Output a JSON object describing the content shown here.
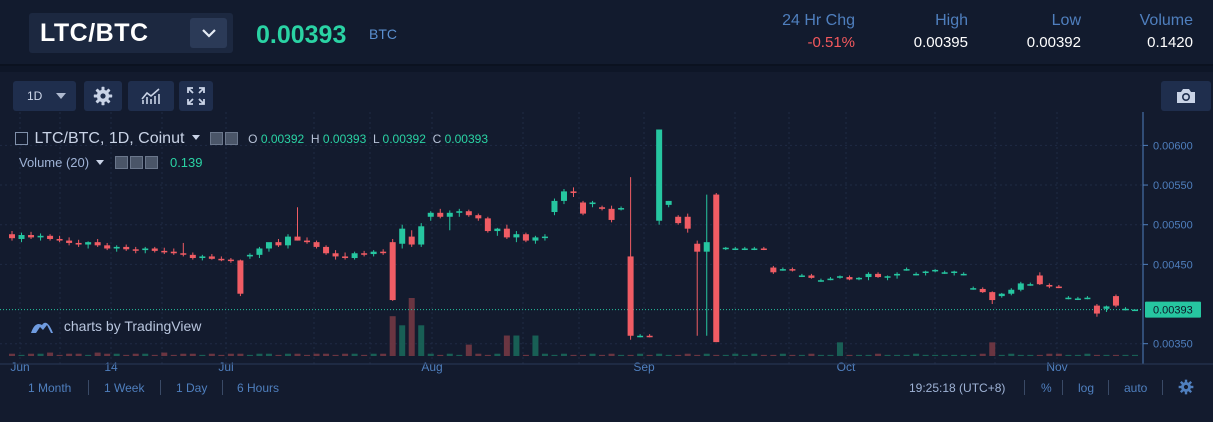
{
  "ticker": {
    "pair": "LTC/BTC",
    "price": "0.00393",
    "unit": "BTC",
    "stats": [
      {
        "label": "24 Hr Chg",
        "value": "-0.51%"
      },
      {
        "label": "High",
        "value": "0.00395"
      },
      {
        "label": "Low",
        "value": "0.00392"
      },
      {
        "label": "Volume",
        "value": "0.1420"
      }
    ]
  },
  "toolbar": {
    "interval": "1D"
  },
  "legend": {
    "title": "LTC/BTC, 1D, Coinut",
    "o_label": "O",
    "o": "0.00392",
    "h_label": "H",
    "h": "0.00393",
    "l_label": "L",
    "l": "0.00392",
    "c_label": "C",
    "c": "0.00393",
    "volume_label": "Volume (20)",
    "volume_value": "0.139"
  },
  "watermark": "charts by TradingView",
  "bottom": {
    "ranges": [
      "1 Month",
      "1 Week",
      "1 Day",
      "6 Hours"
    ],
    "time": "19:25:18 (UTC+8)",
    "percent": "%",
    "log": "log",
    "auto": "auto"
  },
  "colors": {
    "up": "#26c6a0",
    "down": "#f05c64",
    "accent": "#2ad3a4",
    "label": "#4f7fbe"
  },
  "chart_data": {
    "type": "candlestick",
    "title": "LTC/BTC, 1D, Coinut",
    "x_tick_labels": [
      "Jun",
      "14",
      "Jul",
      "Aug",
      "Sep",
      "Oct",
      "Nov"
    ],
    "y_tick_labels": [
      "0.00600",
      "0.00550",
      "0.00500",
      "0.00450",
      "0.00350"
    ],
    "ylim": [
      0.00337,
      0.00632
    ],
    "last_price_label": "0.00393",
    "grid": true,
    "candles": [
      {
        "o": 0.00488,
        "h": 0.00492,
        "l": 0.0048,
        "c": 0.00483
      },
      {
        "o": 0.00482,
        "h": 0.0049,
        "l": 0.00478,
        "c": 0.00487
      },
      {
        "o": 0.00487,
        "h": 0.00491,
        "l": 0.00482,
        "c": 0.00484
      },
      {
        "o": 0.00484,
        "h": 0.00489,
        "l": 0.0048,
        "c": 0.00486
      },
      {
        "o": 0.00486,
        "h": 0.00488,
        "l": 0.0048,
        "c": 0.00482
      },
      {
        "o": 0.00482,
        "h": 0.00486,
        "l": 0.00478,
        "c": 0.0048
      },
      {
        "o": 0.0048,
        "h": 0.00484,
        "l": 0.00474,
        "c": 0.00477
      },
      {
        "o": 0.00477,
        "h": 0.00481,
        "l": 0.00472,
        "c": 0.00475
      },
      {
        "o": 0.00475,
        "h": 0.00479,
        "l": 0.0047,
        "c": 0.00478
      },
      {
        "o": 0.00478,
        "h": 0.00482,
        "l": 0.00472,
        "c": 0.00474
      },
      {
        "o": 0.00474,
        "h": 0.00477,
        "l": 0.00468,
        "c": 0.0047
      },
      {
        "o": 0.0047,
        "h": 0.00474,
        "l": 0.00466,
        "c": 0.00472
      },
      {
        "o": 0.00472,
        "h": 0.00475,
        "l": 0.00467,
        "c": 0.00469
      },
      {
        "o": 0.00469,
        "h": 0.00472,
        "l": 0.00464,
        "c": 0.00468
      },
      {
        "o": 0.00468,
        "h": 0.00472,
        "l": 0.00464,
        "c": 0.0047
      },
      {
        "o": 0.0047,
        "h": 0.00472,
        "l": 0.00465,
        "c": 0.00467
      },
      {
        "o": 0.00467,
        "h": 0.00471,
        "l": 0.00463,
        "c": 0.00466
      },
      {
        "o": 0.00466,
        "h": 0.0047,
        "l": 0.00462,
        "c": 0.00464
      },
      {
        "o": 0.00464,
        "h": 0.00477,
        "l": 0.0046,
        "c": 0.00463
      },
      {
        "o": 0.00462,
        "h": 0.00465,
        "l": 0.00456,
        "c": 0.00458
      },
      {
        "o": 0.00458,
        "h": 0.00462,
        "l": 0.00455,
        "c": 0.0046
      },
      {
        "o": 0.0046,
        "h": 0.00463,
        "l": 0.00456,
        "c": 0.00457
      },
      {
        "o": 0.00457,
        "h": 0.0046,
        "l": 0.00454,
        "c": 0.00456
      },
      {
        "o": 0.00456,
        "h": 0.00458,
        "l": 0.00452,
        "c": 0.00455
      },
      {
        "o": 0.00455,
        "h": 0.00456,
        "l": 0.0041,
        "c": 0.00413
      },
      {
        "o": 0.0046,
        "h": 0.00464,
        "l": 0.00457,
        "c": 0.00462
      },
      {
        "o": 0.00462,
        "h": 0.00472,
        "l": 0.00458,
        "c": 0.0047
      },
      {
        "o": 0.0047,
        "h": 0.00476,
        "l": 0.00466,
        "c": 0.00478
      },
      {
        "o": 0.00478,
        "h": 0.00482,
        "l": 0.00472,
        "c": 0.00474
      },
      {
        "o": 0.00474,
        "h": 0.00488,
        "l": 0.0047,
        "c": 0.00485
      },
      {
        "o": 0.00485,
        "h": 0.00522,
        "l": 0.0048,
        "c": 0.0048
      },
      {
        "o": 0.0048,
        "h": 0.00484,
        "l": 0.00476,
        "c": 0.00478
      },
      {
        "o": 0.00478,
        "h": 0.0048,
        "l": 0.0047,
        "c": 0.00472
      },
      {
        "o": 0.00472,
        "h": 0.00474,
        "l": 0.00462,
        "c": 0.00464
      },
      {
        "o": 0.00464,
        "h": 0.00468,
        "l": 0.00456,
        "c": 0.0046
      },
      {
        "o": 0.0046,
        "h": 0.00465,
        "l": 0.00456,
        "c": 0.00458
      },
      {
        "o": 0.00458,
        "h": 0.00466,
        "l": 0.00456,
        "c": 0.00464
      },
      {
        "o": 0.00464,
        "h": 0.00467,
        "l": 0.0046,
        "c": 0.00463
      },
      {
        "o": 0.00463,
        "h": 0.00468,
        "l": 0.0046,
        "c": 0.00466
      },
      {
        "o": 0.00466,
        "h": 0.00469,
        "l": 0.00462,
        "c": 0.00465
      },
      {
        "o": 0.00478,
        "h": 0.00482,
        "l": 0.00404,
        "c": 0.00405
      },
      {
        "o": 0.00476,
        "h": 0.005,
        "l": 0.0047,
        "c": 0.00495
      },
      {
        "o": 0.00485,
        "h": 0.00493,
        "l": 0.00472,
        "c": 0.00475
      },
      {
        "o": 0.00475,
        "h": 0.00502,
        "l": 0.00472,
        "c": 0.00498
      },
      {
        "o": 0.0051,
        "h": 0.00517,
        "l": 0.00505,
        "c": 0.00515
      },
      {
        "o": 0.00515,
        "h": 0.0052,
        "l": 0.00508,
        "c": 0.0051
      },
      {
        "o": 0.0051,
        "h": 0.00518,
        "l": 0.00493,
        "c": 0.00515
      },
      {
        "o": 0.00515,
        "h": 0.0052,
        "l": 0.0051,
        "c": 0.00517
      },
      {
        "o": 0.00517,
        "h": 0.00519,
        "l": 0.0051,
        "c": 0.00512
      },
      {
        "o": 0.00512,
        "h": 0.00514,
        "l": 0.00505,
        "c": 0.00508
      },
      {
        "o": 0.00508,
        "h": 0.0051,
        "l": 0.0049,
        "c": 0.00492
      },
      {
        "o": 0.00492,
        "h": 0.00496,
        "l": 0.00486,
        "c": 0.00495
      },
      {
        "o": 0.00495,
        "h": 0.005,
        "l": 0.00482,
        "c": 0.00484
      },
      {
        "o": 0.00484,
        "h": 0.00492,
        "l": 0.00478,
        "c": 0.00488
      },
      {
        "o": 0.00488,
        "h": 0.0049,
        "l": 0.00478,
        "c": 0.0048
      },
      {
        "o": 0.0048,
        "h": 0.00486,
        "l": 0.00476,
        "c": 0.00484
      },
      {
        "o": 0.00484,
        "h": 0.00488,
        "l": 0.0048,
        "c": 0.00485
      },
      {
        "o": 0.00516,
        "h": 0.00533,
        "l": 0.00512,
        "c": 0.0053
      },
      {
        "o": 0.0053,
        "h": 0.00545,
        "l": 0.00526,
        "c": 0.00542
      },
      {
        "o": 0.00542,
        "h": 0.00547,
        "l": 0.00535,
        "c": 0.0054
      },
      {
        "o": 0.00528,
        "h": 0.0053,
        "l": 0.00512,
        "c": 0.00514
      },
      {
        "o": 0.00526,
        "h": 0.0053,
        "l": 0.00522,
        "c": 0.00528
      },
      {
        "o": 0.00522,
        "h": 0.00524,
        "l": 0.00518,
        "c": 0.0052
      },
      {
        "o": 0.0052,
        "h": 0.00524,
        "l": 0.00503,
        "c": 0.00506
      },
      {
        "o": 0.0052,
        "h": 0.00523,
        "l": 0.00518,
        "c": 0.00521
      },
      {
        "o": 0.0046,
        "h": 0.0056,
        "l": 0.00355,
        "c": 0.0036
      },
      {
        "o": 0.0036,
        "h": 0.00362,
        "l": 0.00358,
        "c": 0.0036
      },
      {
        "o": 0.0036,
        "h": 0.00362,
        "l": 0.00358,
        "c": 0.00359
      },
      {
        "o": 0.00505,
        "h": 0.0062,
        "l": 0.005,
        "c": 0.0062
      },
      {
        "o": 0.00525,
        "h": 0.0053,
        "l": 0.00522,
        "c": 0.0053
      },
      {
        "o": 0.0051,
        "h": 0.00512,
        "l": 0.005,
        "c": 0.00502
      },
      {
        "o": 0.0051,
        "h": 0.00514,
        "l": 0.0049,
        "c": 0.00495
      },
      {
        "o": 0.00476,
        "h": 0.0048,
        "l": 0.0036,
        "c": 0.00466
      },
      {
        "o": 0.00466,
        "h": 0.00538,
        "l": 0.0036,
        "c": 0.00478
      },
      {
        "o": 0.00538,
        "h": 0.0054,
        "l": 0.00352,
        "c": 0.00352
      },
      {
        "o": 0.0047,
        "h": 0.00472,
        "l": 0.00468,
        "c": 0.00471
      },
      {
        "o": 0.0047,
        "h": 0.00472,
        "l": 0.00468,
        "c": 0.0047
      },
      {
        "o": 0.0047,
        "h": 0.00472,
        "l": 0.00468,
        "c": 0.0047
      },
      {
        "o": 0.0047,
        "h": 0.00472,
        "l": 0.00468,
        "c": 0.0047
      },
      {
        "o": 0.0047,
        "h": 0.00472,
        "l": 0.00468,
        "c": 0.00469
      },
      {
        "o": 0.00446,
        "h": 0.00448,
        "l": 0.00438,
        "c": 0.0044
      },
      {
        "o": 0.00444,
        "h": 0.00446,
        "l": 0.00442,
        "c": 0.00444
      },
      {
        "o": 0.00444,
        "h": 0.00446,
        "l": 0.00441,
        "c": 0.00443
      },
      {
        "o": 0.00436,
        "h": 0.00438,
        "l": 0.00434,
        "c": 0.00436
      },
      {
        "o": 0.00436,
        "h": 0.00438,
        "l": 0.00432,
        "c": 0.00433
      },
      {
        "o": 0.0043,
        "h": 0.00432,
        "l": 0.00428,
        "c": 0.0043
      },
      {
        "o": 0.00432,
        "h": 0.00434,
        "l": 0.0043,
        "c": 0.00432
      },
      {
        "o": 0.00434,
        "h": 0.00436,
        "l": 0.00432,
        "c": 0.00435
      },
      {
        "o": 0.00434,
        "h": 0.00436,
        "l": 0.0043,
        "c": 0.00431
      },
      {
        "o": 0.00432,
        "h": 0.00434,
        "l": 0.0043,
        "c": 0.00433
      },
      {
        "o": 0.00434,
        "h": 0.0044,
        "l": 0.0043,
        "c": 0.00438
      },
      {
        "o": 0.00438,
        "h": 0.0044,
        "l": 0.00433,
        "c": 0.00434
      },
      {
        "o": 0.00434,
        "h": 0.00436,
        "l": 0.0043,
        "c": 0.00435
      },
      {
        "o": 0.00436,
        "h": 0.0044,
        "l": 0.00432,
        "c": 0.00438
      },
      {
        "o": 0.00444,
        "h": 0.00446,
        "l": 0.00442,
        "c": 0.00444
      },
      {
        "o": 0.00438,
        "h": 0.0044,
        "l": 0.00436,
        "c": 0.00438
      },
      {
        "o": 0.0044,
        "h": 0.00442,
        "l": 0.00436,
        "c": 0.00441
      },
      {
        "o": 0.00442,
        "h": 0.00444,
        "l": 0.0044,
        "c": 0.00443
      },
      {
        "o": 0.0044,
        "h": 0.00442,
        "l": 0.00438,
        "c": 0.0044
      },
      {
        "o": 0.0044,
        "h": 0.00442,
        "l": 0.00436,
        "c": 0.00441
      },
      {
        "o": 0.00438,
        "h": 0.0044,
        "l": 0.00436,
        "c": 0.00438
      },
      {
        "o": 0.0042,
        "h": 0.00422,
        "l": 0.00418,
        "c": 0.0042
      },
      {
        "o": 0.00419,
        "h": 0.00421,
        "l": 0.00414,
        "c": 0.00415
      },
      {
        "o": 0.00415,
        "h": 0.00416,
        "l": 0.004,
        "c": 0.00405
      },
      {
        "o": 0.0041,
        "h": 0.00414,
        "l": 0.00408,
        "c": 0.00413
      },
      {
        "o": 0.00413,
        "h": 0.0042,
        "l": 0.00411,
        "c": 0.00418
      },
      {
        "o": 0.00418,
        "h": 0.00428,
        "l": 0.00416,
        "c": 0.00426
      },
      {
        "o": 0.00425,
        "h": 0.00427,
        "l": 0.00423,
        "c": 0.00425
      },
      {
        "o": 0.00436,
        "h": 0.0044,
        "l": 0.00424,
        "c": 0.00425
      },
      {
        "o": 0.00424,
        "h": 0.00426,
        "l": 0.0042,
        "c": 0.00422
      },
      {
        "o": 0.00422,
        "h": 0.00424,
        "l": 0.0042,
        "c": 0.00421
      },
      {
        "o": 0.00408,
        "h": 0.0041,
        "l": 0.00406,
        "c": 0.00408
      },
      {
        "o": 0.00407,
        "h": 0.00409,
        "l": 0.00405,
        "c": 0.00407
      },
      {
        "o": 0.00408,
        "h": 0.0041,
        "l": 0.00406,
        "c": 0.00408
      },
      {
        "o": 0.00398,
        "h": 0.004,
        "l": 0.00384,
        "c": 0.00388
      },
      {
        "o": 0.00394,
        "h": 0.00398,
        "l": 0.0039,
        "c": 0.00397
      },
      {
        "o": 0.0041,
        "h": 0.00412,
        "l": 0.00396,
        "c": 0.00398
      },
      {
        "o": 0.00394,
        "h": 0.00396,
        "l": 0.00392,
        "c": 0.00394
      },
      {
        "o": 0.00392,
        "h": 0.00393,
        "l": 0.00392,
        "c": 0.00393
      }
    ],
    "volume": [
      0.02,
      0.01,
      0.02,
      0.02,
      0.03,
      0.01,
      0.02,
      0.02,
      0.01,
      0.03,
      0.02,
      0.02,
      0.01,
      0.02,
      0.02,
      0.01,
      0.03,
      0.01,
      0.02,
      0.02,
      0.01,
      0.02,
      0.01,
      0.02,
      0.02,
      0.01,
      0.02,
      0.02,
      0.01,
      0.02,
      0.02,
      0.01,
      0.02,
      0.02,
      0.01,
      0.02,
      0.02,
      0.01,
      0.02,
      0.02,
      0.35,
      0.27,
      0.51,
      0.27,
      0.02,
      0.01,
      0.02,
      0.01,
      0.1,
      0.02,
      0.01,
      0.02,
      0.18,
      0.18,
      0.01,
      0.18,
      0.02,
      0.01,
      0.02,
      0.01,
      0.01,
      0.02,
      0.01,
      0.02,
      0.01,
      0.01,
      0.02,
      0.01,
      0.02,
      0.01,
      0.01,
      0.02,
      0.01,
      0.02,
      0.01,
      0.01,
      0.02,
      0.01,
      0.02,
      0.01,
      0.01,
      0.02,
      0.01,
      0.01,
      0.02,
      0.01,
      0.01,
      0.12,
      0.01,
      0.01,
      0.01,
      0.02,
      0.01,
      0.01,
      0.01,
      0.02,
      0.01,
      0.01,
      0.01,
      0.01,
      0.01,
      0.01,
      0.02,
      0.12,
      0.01,
      0.02,
      0.01,
      0.01,
      0.01,
      0.02,
      0.02,
      0.01,
      0.01,
      0.02,
      0.01,
      0.01,
      0.01,
      0.01,
      0.01
    ],
    "volume_colors": "match-candle"
  }
}
